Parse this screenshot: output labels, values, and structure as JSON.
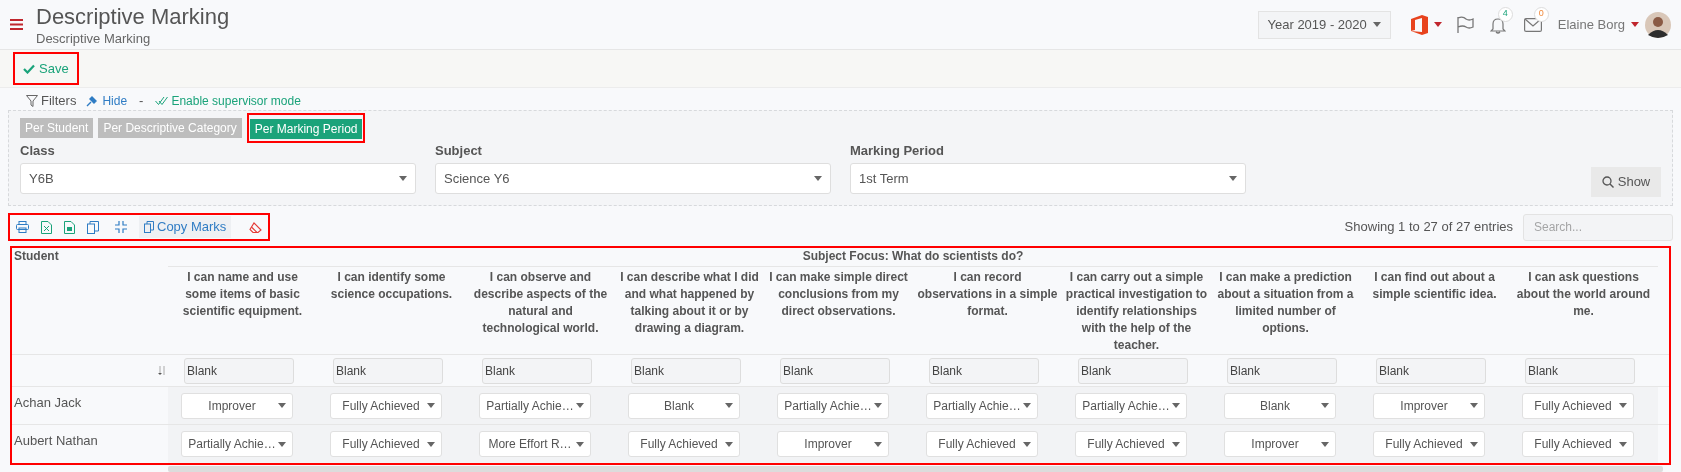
{
  "header": {
    "title": "Descriptive Marking",
    "subtitle": "Descriptive Marking",
    "year": "Year 2019 - 2020",
    "notifications": "4",
    "messages": "0",
    "user": "Elaine Borg"
  },
  "save": "Save",
  "filters": {
    "label": "Filters",
    "hide": "Hide",
    "separator": "-",
    "supervisor": "Enable supervisor mode"
  },
  "view_tabs": [
    {
      "label": "Per Student",
      "selected": false
    },
    {
      "label": "Per Descriptive Category",
      "selected": false
    },
    {
      "label": "Per Marking Period",
      "selected": true
    }
  ],
  "fields": [
    {
      "label": "Class",
      "value": "Y6B"
    },
    {
      "label": "Subject",
      "value": "Science Y6"
    },
    {
      "label": "Marking Period",
      "value": "1st Term"
    }
  ],
  "show_button": "Show",
  "toolbar": {
    "copy_marks": "Copy Marks"
  },
  "showing": "Showing 1 to 27 of 27 entries",
  "search": {
    "placeholder": "Search..."
  },
  "table": {
    "student_header": "Student",
    "group_header": "Subject Focus: What do scientists do?",
    "columns": [
      "I can name and use some items of basic scientific equipment.",
      "I can identify some science occupations.",
      "I can observe and describe aspects of the natural and technological world.",
      "I can describe what I did and what happened by talking about it or by drawing a diagram.",
      "I can make simple direct conclusions from my direct observations.",
      "I can record observations in a simple format.",
      "I can carry out a simple practical investigation to identify relationships with the help of the teacher.",
      "I can make a prediction about a situation from a limited number of options.",
      "I can find out about a simple scientific idea.",
      "I can ask questions about the world around me."
    ],
    "filter_values": [
      "Blank",
      "Blank",
      "Blank",
      "Blank",
      "Blank",
      "Blank",
      "Blank",
      "Blank",
      "Blank",
      "Blank"
    ],
    "rows": [
      {
        "name": "Achan Jack",
        "marks": [
          "Improver",
          "Fully Achieved",
          "Partially Achie…",
          "Blank",
          "Partially Achie…",
          "Partially Achie…",
          "Partially Achie…",
          "Blank",
          "Improver",
          "Fully Achieved"
        ]
      },
      {
        "name": "Aubert Nathan",
        "marks": [
          "Partially Achie…",
          "Fully Achieved",
          "More Effort R…",
          "Fully Achieved",
          "Improver",
          "Fully Achieved",
          "Fully Achieved",
          "Improver",
          "Fully Achieved",
          "Fully Achieved"
        ]
      }
    ]
  }
}
